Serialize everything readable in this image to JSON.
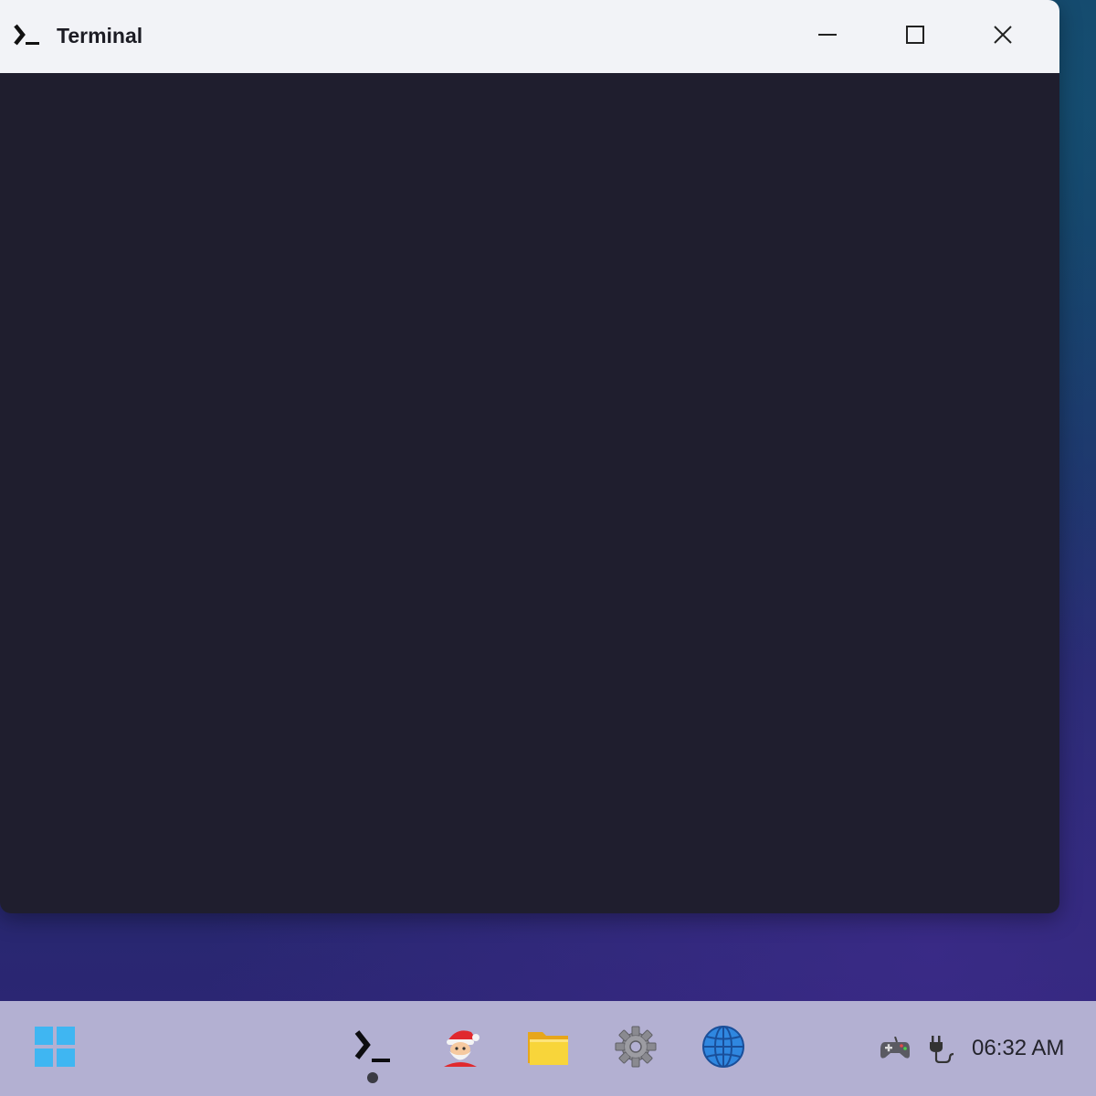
{
  "window": {
    "title": "Terminal",
    "icon": "terminal-icon",
    "controls": {
      "minimize": "minimize-icon",
      "maximize": "maximize-icon",
      "close": "close-icon"
    }
  },
  "taskbar": {
    "start_icon": "windows-start-icon",
    "apps": [
      {
        "name": "terminal",
        "icon": "terminal-icon",
        "active": true
      },
      {
        "name": "santa",
        "icon": "santa-claus-icon",
        "active": false
      },
      {
        "name": "files",
        "icon": "folder-icon",
        "active": false
      },
      {
        "name": "settings",
        "icon": "gear-icon",
        "active": false
      },
      {
        "name": "browser",
        "icon": "globe-icon",
        "active": false
      }
    ],
    "tray": {
      "gamepad_icon": "gamepad-icon",
      "power_icon": "power-plug-icon",
      "clock": "06:32 AM"
    }
  },
  "colors": {
    "titlebar": "#f2f3f7",
    "terminal_bg": "#1f1e2e",
    "taskbar": "#b3b0d2",
    "start_accent": "#3fb6f2"
  }
}
